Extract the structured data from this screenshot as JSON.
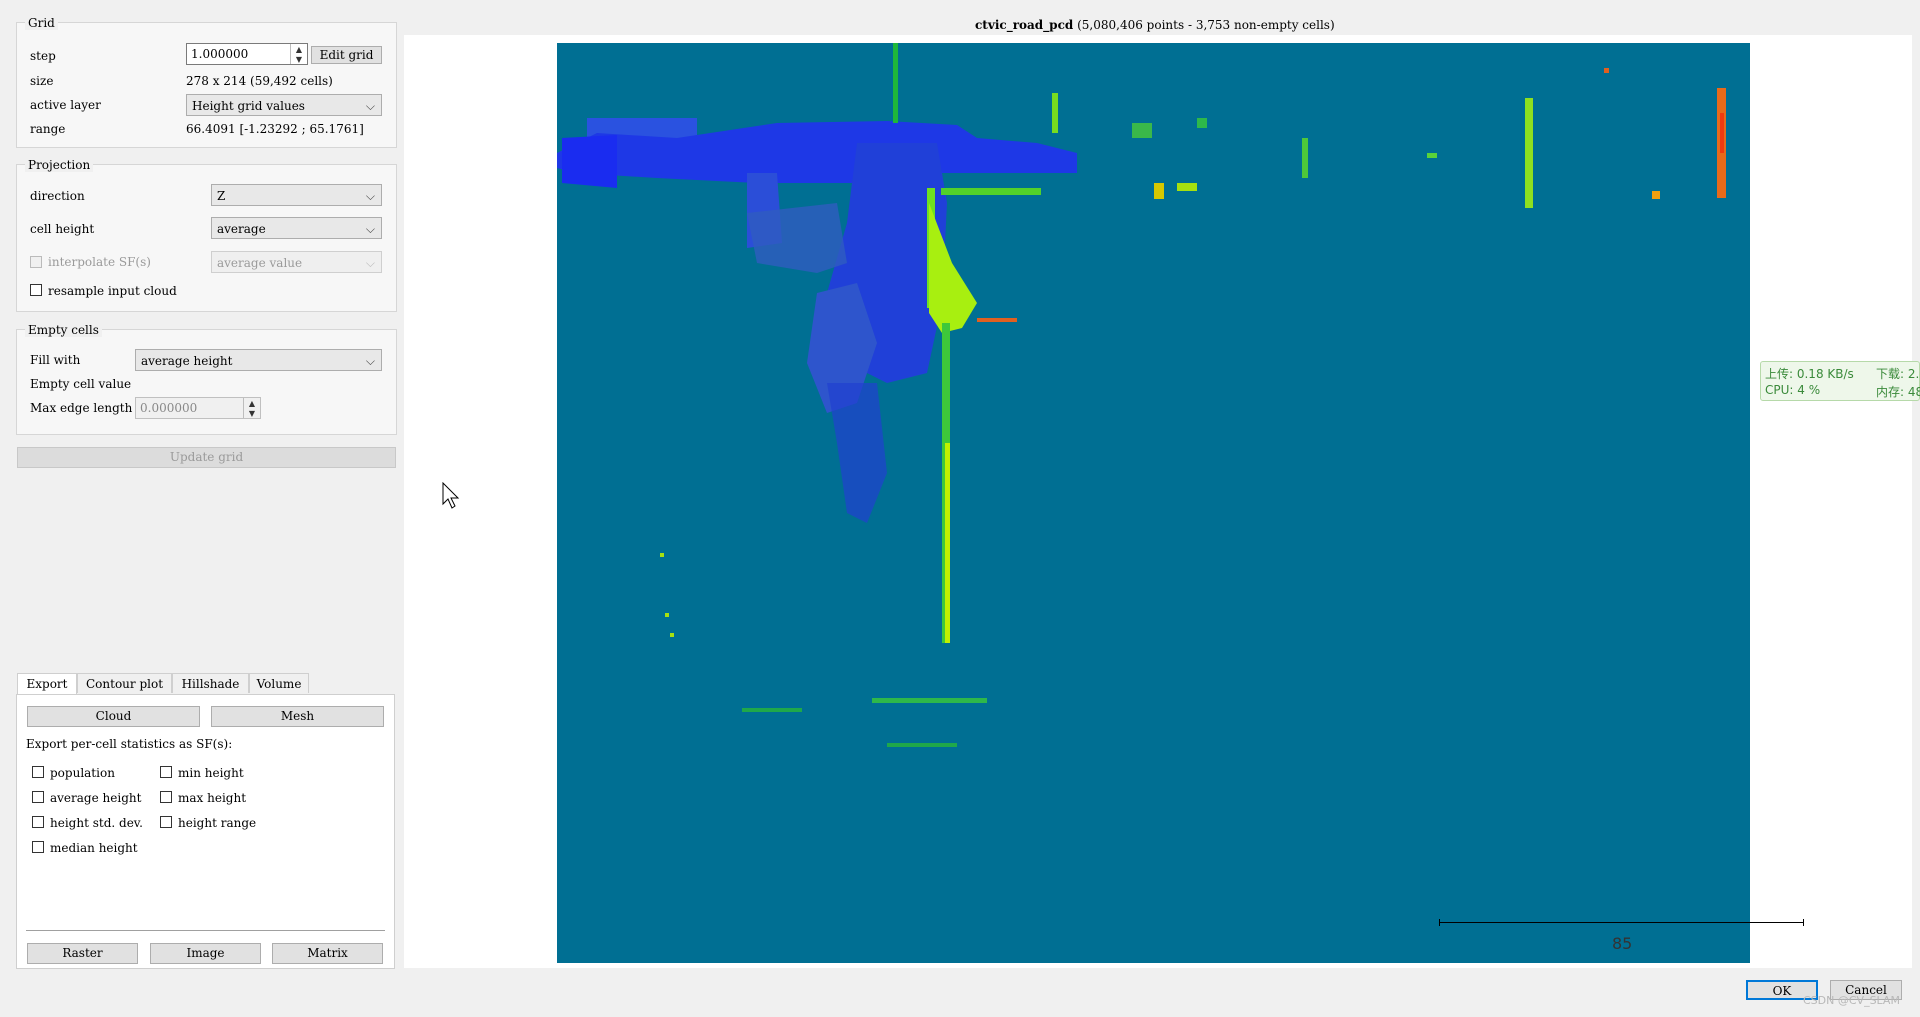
{
  "grid": {
    "title": "Grid",
    "step_label": "step",
    "step_value": "1.000000",
    "edit_grid_button": "Edit grid",
    "size_label": "size",
    "size_value": "278 x 214 (59,492 cells)",
    "active_layer_label": "active layer",
    "active_layer_value": "Height grid values",
    "range_label": "range",
    "range_value": "66.4091 [-1.23292 ; 65.1761]"
  },
  "projection": {
    "title": "Projection",
    "direction_label": "direction",
    "direction_value": "Z",
    "cell_height_label": "cell height",
    "cell_height_value": "average",
    "interpolate_label": "interpolate SF(s)",
    "interpolate_value": "average value",
    "resample_label": "resample input cloud"
  },
  "empty_cells": {
    "title": "Empty cells",
    "fill_with_label": "Fill with",
    "fill_with_value": "average height",
    "empty_cell_value_label": "Empty cell value",
    "max_edge_label": "Max edge length",
    "max_edge_value": "0.000000"
  },
  "update_grid_button": "Update grid",
  "tabs": [
    "Export",
    "Contour plot",
    "Hillshade",
    "Volume"
  ],
  "export": {
    "cloud_button": "Cloud",
    "mesh_button": "Mesh",
    "stats_label": "Export per-cell statistics as SF(s):",
    "checkboxes_left": [
      "population",
      "average height",
      "height std. dev.",
      "median height"
    ],
    "checkboxes_right": [
      "min height",
      "max height",
      "height range"
    ],
    "raster_button": "Raster",
    "image_button": "Image",
    "matrix_button": "Matrix"
  },
  "viewer": {
    "title_name": "ctvic_road_pcd",
    "title_info": "(5,080,406 points - 3,753 non-empty cells)",
    "scale_value": "85"
  },
  "tray": {
    "upload": "上传: 0.18 KB/s",
    "download": "下载: 2.",
    "cpu": "CPU: 4 %",
    "memory": "内存: 48"
  },
  "footer": {
    "ok_button": "OK",
    "cancel_button": "Cancel",
    "watermark": "CSDN @CV_SLAM"
  },
  "colors": {
    "background_cell": "#006f93",
    "low": "#1f3fe0",
    "mid": "#2eb82e",
    "high": "#b6f000",
    "peak": "#e84a1a"
  }
}
